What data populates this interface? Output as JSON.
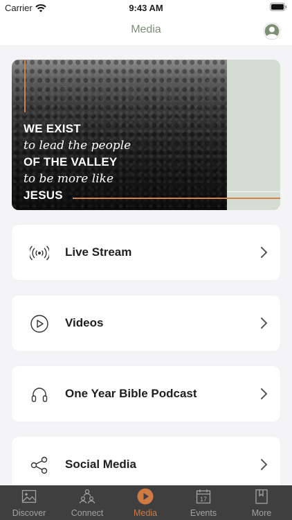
{
  "status_bar": {
    "carrier": "Carrier",
    "time": "9:43 AM"
  },
  "header": {
    "title": "Media",
    "profile_icon": "person-circle-icon"
  },
  "hero": {
    "lines": [
      "WE EXIST",
      "to lead the people",
      "OF THE VALLEY",
      "to be more like",
      "JESUS"
    ],
    "colors": {
      "accent": "#d0844a",
      "panel": "#d4ddd1"
    }
  },
  "menu": {
    "items": [
      {
        "label": "Live Stream",
        "icon": "broadcast-icon"
      },
      {
        "label": "Videos",
        "icon": "play-circle-icon"
      },
      {
        "label": "One Year Bible Podcast",
        "icon": "headphones-icon"
      },
      {
        "label": "Social Media",
        "icon": "share-icon"
      }
    ]
  },
  "tabs": {
    "items": [
      {
        "label": "Discover",
        "icon": "image-icon"
      },
      {
        "label": "Connect",
        "icon": "people-icon"
      },
      {
        "label": "Media",
        "icon": "play-circle-icon",
        "active": true
      },
      {
        "label": "Events",
        "icon": "calendar-icon",
        "badge": "17"
      },
      {
        "label": "More",
        "icon": "bookmark-icon"
      }
    ]
  },
  "colors": {
    "brand_green": "#7d8f74",
    "active_tab": "#cd7a43",
    "tab_bar_bg": "#3f3f3f"
  }
}
